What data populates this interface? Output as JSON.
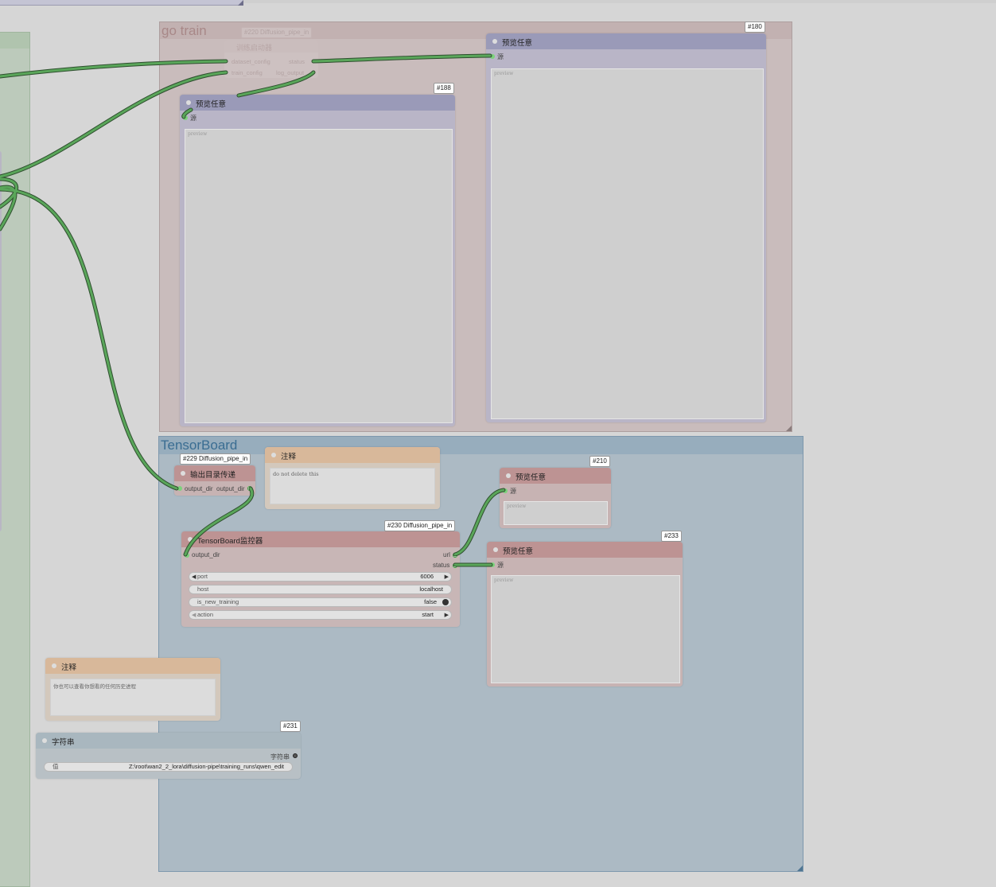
{
  "groups": {
    "go_train": {
      "title": "go train"
    },
    "tensorboard": {
      "title": "TensorBoard"
    }
  },
  "nodes": {
    "ghost": {
      "badge": "#220 Diffusion_pipe_in",
      "title": "训练启动器",
      "in1": "dataset_config",
      "in2": "train_config",
      "out1": "status",
      "out2": "log_output"
    },
    "preview180": {
      "id": "#180",
      "title": "预览任意",
      "input": "源",
      "preview": "preview"
    },
    "preview188": {
      "id": "#188",
      "title": "预览任意",
      "input": "源",
      "preview": "preview"
    },
    "output_dir_node": {
      "badge": "#229 Diffusion_pipe_in",
      "title": "输出目录传递",
      "input": "output_dir",
      "output": "output_dir"
    },
    "note_top": {
      "title": "注释",
      "text": "do not delete this"
    },
    "preview210": {
      "id": "#210",
      "title": "预览任意",
      "input": "源",
      "preview": "preview"
    },
    "tensorboard_monitor": {
      "badge": "#230 Diffusion_pipe_in",
      "title": "TensorBoard监控器",
      "input": "output_dir",
      "out_url": "url",
      "out_status": "status",
      "widgets": [
        {
          "label": "port",
          "value": "6006"
        },
        {
          "label": "host",
          "value": "localhost"
        },
        {
          "label": "is_new_training",
          "value": "false"
        },
        {
          "label": "action",
          "value": "start"
        }
      ]
    },
    "preview233": {
      "id": "#233",
      "title": "预览任意",
      "input": "源",
      "preview": "preview"
    },
    "note_bottom": {
      "title": "注释",
      "text": "你也可以查看你想看的任何历史进程"
    },
    "string231": {
      "id": "#231",
      "title": "字符串",
      "output": "字符串",
      "widget_label": "值",
      "widget_value": "Z:\\root\\wan2_2_lora\\diffusion-pipe\\training_runs\\qwen_edit"
    }
  },
  "colors": {
    "link": "#4e9a4e",
    "go_train_group": "#c7bcbc",
    "tensorboard_group": "#a9b8c2",
    "left_group": "#bccabb",
    "preview_header": "#9a9ab8",
    "preview_body": "#b9b6c8",
    "red_header": "#bd9393",
    "red_body": "#c7b3b3",
    "note_header": "#d8b89a",
    "note_body": "#d3c8bc",
    "string_header": "#a9b7bf",
    "string_body": "#b8c0c5"
  }
}
